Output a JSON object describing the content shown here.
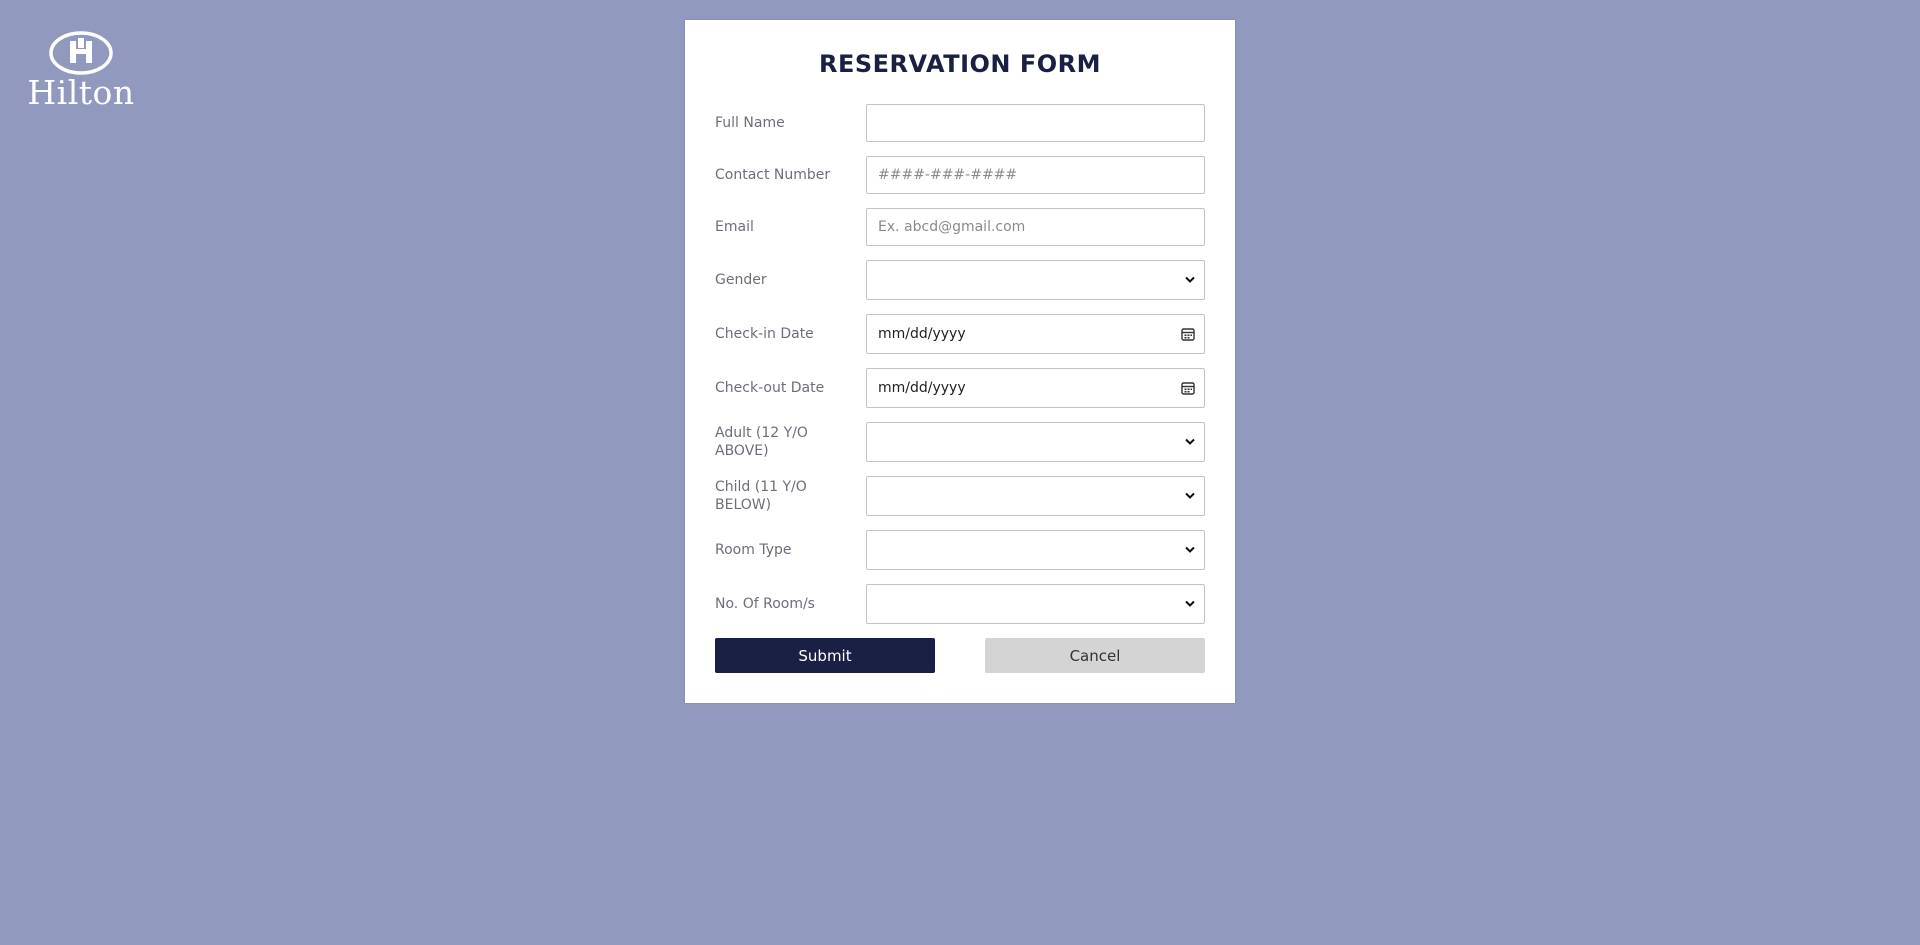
{
  "brand": {
    "logo_text": "Hilton"
  },
  "form": {
    "title": "RESERVATION FORM",
    "fields": [
      {
        "label": "Full Name",
        "type": "text",
        "value": "",
        "placeholder": ""
      },
      {
        "label": "Contact Number",
        "type": "text",
        "value": "",
        "placeholder": "####-###-####"
      },
      {
        "label": "Email",
        "type": "text",
        "value": "",
        "placeholder": "Ex. abcd@gmail.com"
      },
      {
        "label": "Gender",
        "type": "select",
        "value": ""
      },
      {
        "label": "Check-in Date",
        "type": "date",
        "value": "mm/dd/yyyy"
      },
      {
        "label": "Check-out Date",
        "type": "date",
        "value": "mm/dd/yyyy"
      },
      {
        "label": "Adult (12 Y/O ABOVE)",
        "type": "select",
        "value": ""
      },
      {
        "label": "Child (11 Y/O BELOW)",
        "type": "select",
        "value": ""
      },
      {
        "label": "Room Type",
        "type": "select",
        "value": ""
      },
      {
        "label": "No. Of Room/s",
        "type": "select",
        "value": ""
      }
    ],
    "submit_label": "Submit",
    "cancel_label": "Cancel"
  },
  "colors": {
    "background": "#9299bf",
    "primary": "#1a1f44",
    "cancel": "#d4d4d4"
  },
  "icons": [
    "hilton-logo-icon",
    "chevron-down-icon",
    "calendar-icon"
  ]
}
